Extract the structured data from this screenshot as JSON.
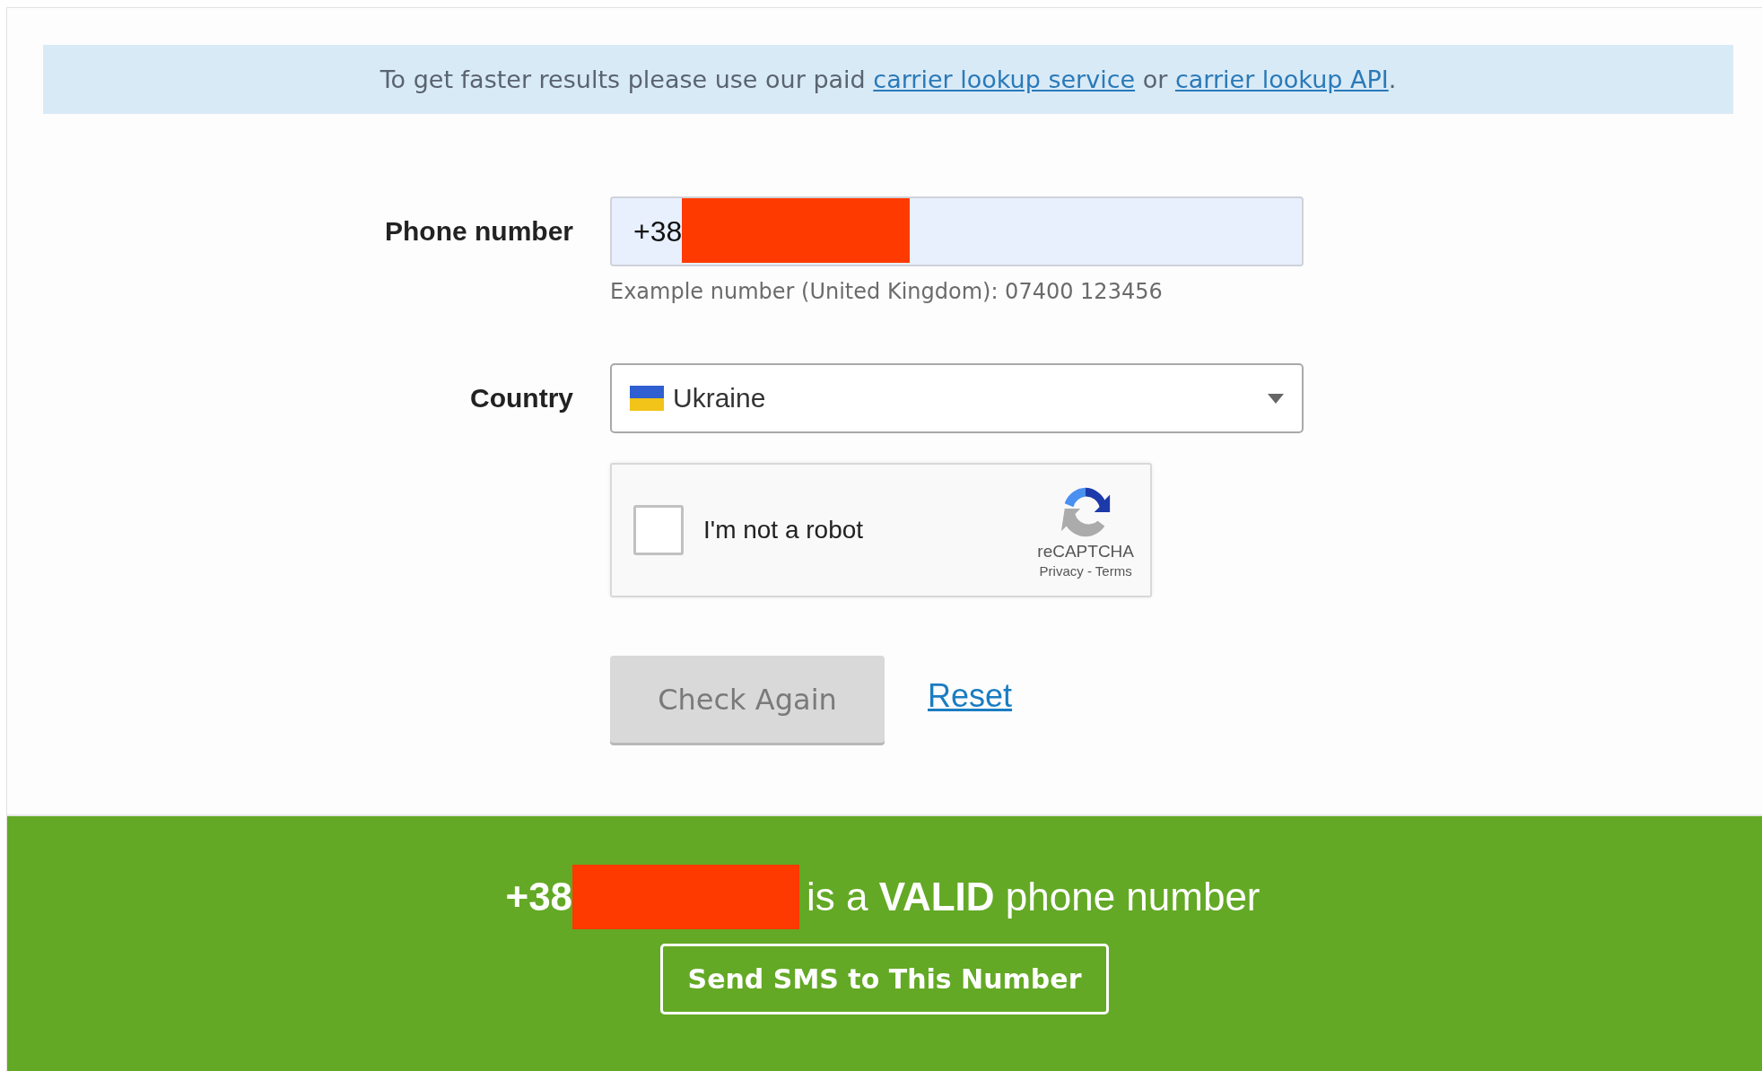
{
  "banner": {
    "parts": [
      {
        "kind": "text",
        "text": "To get faster results please use our paid "
      },
      {
        "kind": "link",
        "text": "carrier lookup service"
      },
      {
        "kind": "text",
        "text": " or "
      },
      {
        "kind": "link",
        "text": "carrier lookup API"
      },
      {
        "kind": "text",
        "text": "."
      }
    ]
  },
  "phone": {
    "label": "Phone number",
    "value": "+38",
    "redacted": true,
    "hint": "Example number (United Kingdom): 07400 123456"
  },
  "country": {
    "label": "Country",
    "value": "Ukraine"
  },
  "captcha": {
    "label": "I'm not a robot",
    "checked": false,
    "brand": "reCAPTCHA",
    "links": "Privacy - Terms"
  },
  "actions": {
    "check": {
      "label": "Check Again",
      "disabled": true
    },
    "reset": "Reset"
  },
  "result": {
    "number": "+38",
    "redacted": true,
    "message": "is a **VALID** phone number",
    "button": "Send SMS to This Number"
  }
}
